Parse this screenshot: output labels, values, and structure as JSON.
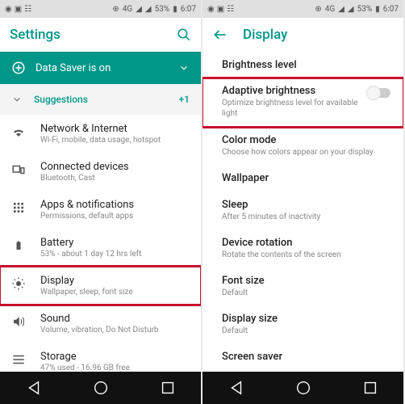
{
  "status": {
    "time": "6:07",
    "battery": "53%",
    "net": "4G"
  },
  "left": {
    "title": "Settings",
    "banner": "Data Saver is on",
    "suggestions_label": "Suggestions",
    "suggestions_count": "+1",
    "items": [
      {
        "title": "Network & Internet",
        "sub": "Wi-Fi, mobile, data usage, hotspot"
      },
      {
        "title": "Connected devices",
        "sub": "Bluetooth, Cast"
      },
      {
        "title": "Apps & notifications",
        "sub": "Permissions, default apps"
      },
      {
        "title": "Battery",
        "sub": "53% - about 1 day 12 hrs left"
      },
      {
        "title": "Display",
        "sub": "Wallpaper, sleep, font size"
      },
      {
        "title": "Sound",
        "sub": "Volume, vibration, Do Not Disturb"
      },
      {
        "title": "Storage",
        "sub": "47% used - 16.96 GB free"
      }
    ]
  },
  "right": {
    "title": "Display",
    "items": [
      {
        "title": "Brightness level",
        "sub": ""
      },
      {
        "title": "Adaptive brightness",
        "sub": "Optimize brightness level for available light"
      },
      {
        "title": "Color mode",
        "sub": "Choose how colors appear on your display"
      },
      {
        "title": "Wallpaper",
        "sub": ""
      },
      {
        "title": "Sleep",
        "sub": "After 5 minutes of inactivity"
      },
      {
        "title": "Device rotation",
        "sub": "Rotate the contents of the screen"
      },
      {
        "title": "Font size",
        "sub": "Default"
      },
      {
        "title": "Display size",
        "sub": "Default"
      },
      {
        "title": "Screen saver",
        "sub": ""
      }
    ]
  }
}
